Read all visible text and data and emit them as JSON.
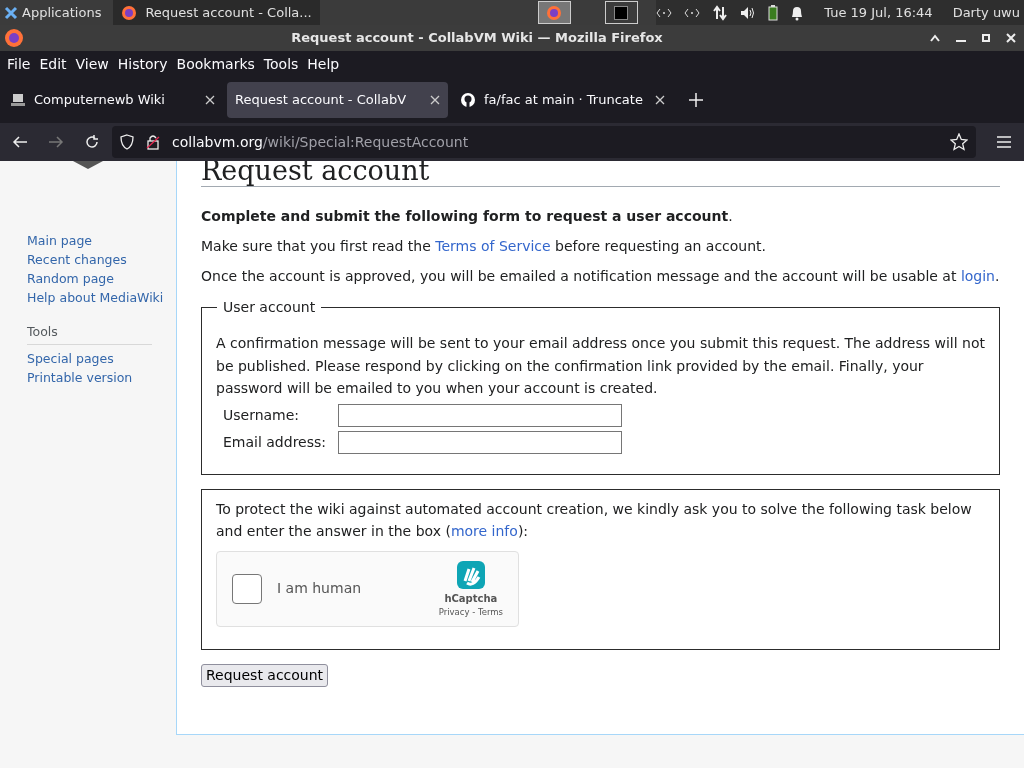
{
  "taskbar": {
    "apps_label": "Applications",
    "window_button": "Request account - Colla...",
    "clock": "Tue 19 Jul, 16:44",
    "user": "Darty uwu"
  },
  "window": {
    "title": "Request account - CollabVM Wiki — Mozilla Firefox"
  },
  "menu": [
    {
      "label": "File"
    },
    {
      "label": "Edit"
    },
    {
      "label": "View"
    },
    {
      "label": "History"
    },
    {
      "label": "Bookmarks"
    },
    {
      "label": "Tools"
    },
    {
      "label": "Help"
    }
  ],
  "tabs": [
    {
      "label": "Computernewb Wiki",
      "selected": false,
      "kind": "wiki"
    },
    {
      "label": "Request account - CollabV",
      "selected": true,
      "kind": "firefox"
    },
    {
      "label": "fa/fac at main · Truncate",
      "selected": false,
      "kind": "github"
    }
  ],
  "url": {
    "host": "collabvm.org",
    "path": "/wiki/Special:RequestAccount"
  },
  "sidebar": {
    "nav": [
      "Main page",
      "Recent changes",
      "Random page",
      "Help about MediaWiki"
    ],
    "tools_heading": "Tools",
    "tools": [
      "Special pages",
      "Printable version"
    ]
  },
  "page": {
    "title": "Request account",
    "lead": "Complete and submit the following form to request a user account",
    "lead_end": ".",
    "tos_before": "Make sure that you first read the ",
    "tos_link": "Terms of Service",
    "tos_after": " before requesting an account.",
    "approved_before": "Once the account is approved, you will be emailed a notification message and the account will be usable at ",
    "approved_link": "login",
    "approved_after": ".",
    "fieldset_legend": "User account",
    "fieldset_text": "A confirmation message will be sent to your email address once you submit this request. The address will not be published. Please respond by clicking on the confirmation link provided by the email. Finally, your password will be emailed to you when your account is created.",
    "fields": [
      {
        "label": "Username:"
      },
      {
        "label": "Email address:"
      }
    ],
    "captcha_before": "To protect the wiki against automated account creation, we kindly ask you to solve the following task below and enter the answer in the box (",
    "captcha_link": "more info",
    "captcha_after": "):",
    "captcha": {
      "label": "I am human",
      "checked": false,
      "brand": "hCaptcha",
      "privacy": "Privacy",
      "sep": " - ",
      "terms": "Terms"
    },
    "submit": "Request account"
  }
}
